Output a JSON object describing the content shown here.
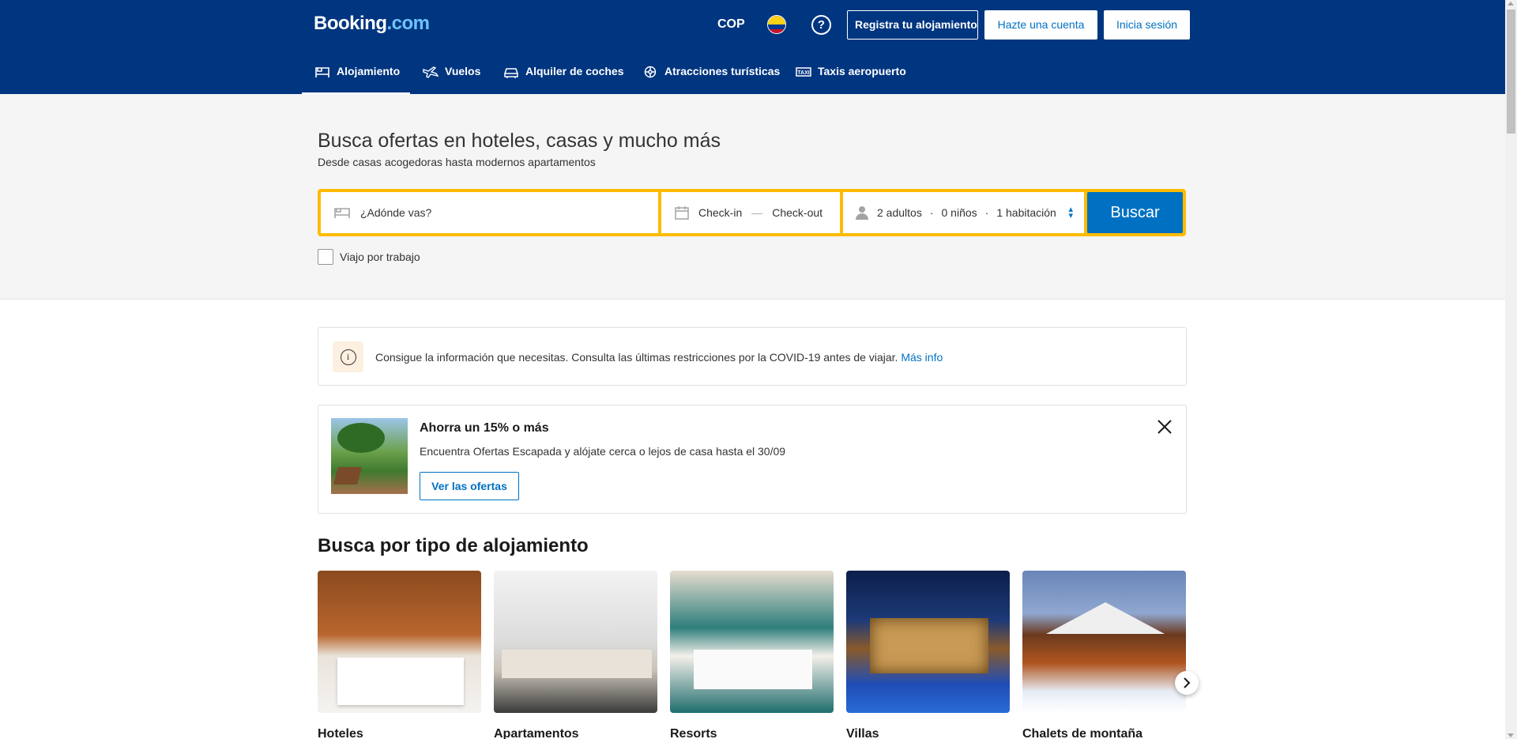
{
  "header": {
    "logo_main": "Booking",
    "logo_dot": ".com",
    "currency": "COP",
    "help_glyph": "?",
    "register_property": "Registra tu alojamiento",
    "create_account": "Hazte una cuenta",
    "sign_in": "Inicia sesión"
  },
  "nav": {
    "items": [
      {
        "label": "Alojamiento",
        "icon": "bed-icon",
        "active": true
      },
      {
        "label": "Vuelos",
        "icon": "plane-icon"
      },
      {
        "label": "Alquiler de coches",
        "icon": "car-icon"
      },
      {
        "label": "Atracciones turísticas",
        "icon": "attractions-icon"
      },
      {
        "label": "Taxis aeropuerto",
        "icon": "taxi-icon"
      }
    ]
  },
  "hero": {
    "title": "Busca ofertas en hoteles, casas y mucho más",
    "subtitle": "Desde casas acogedoras hasta modernos apartamentos"
  },
  "search": {
    "destination_placeholder": "¿Adónde vas?",
    "checkin": "Check-in",
    "dash": "—",
    "checkout": "Check-out",
    "adults": "2 adultos",
    "children": "0 niños",
    "rooms": "1 habitación",
    "dot": "·",
    "button": "Buscar",
    "work_trip": "Viajo por trabajo"
  },
  "notice": {
    "text": "Consigue la información que necesitas. Consulta las últimas restricciones por la COVID-19 antes de viajar.",
    "link": "Más info",
    "icon_glyph": "i"
  },
  "promo": {
    "title": "Ahorra un 15% o más",
    "description": "Encuentra Ofertas Escapada y alójate cerca o lejos de casa hasta el 30/09",
    "button": "Ver las ofertas"
  },
  "property_types": {
    "title": "Busca por tipo de alojamiento",
    "items": [
      "Hoteles",
      "Apartamentos",
      "Resorts",
      "Villas",
      "Chalets de montaña"
    ]
  },
  "colors": {
    "brand_blue": "#003580",
    "action_blue": "#0071c2",
    "search_yellow": "#febb02"
  }
}
